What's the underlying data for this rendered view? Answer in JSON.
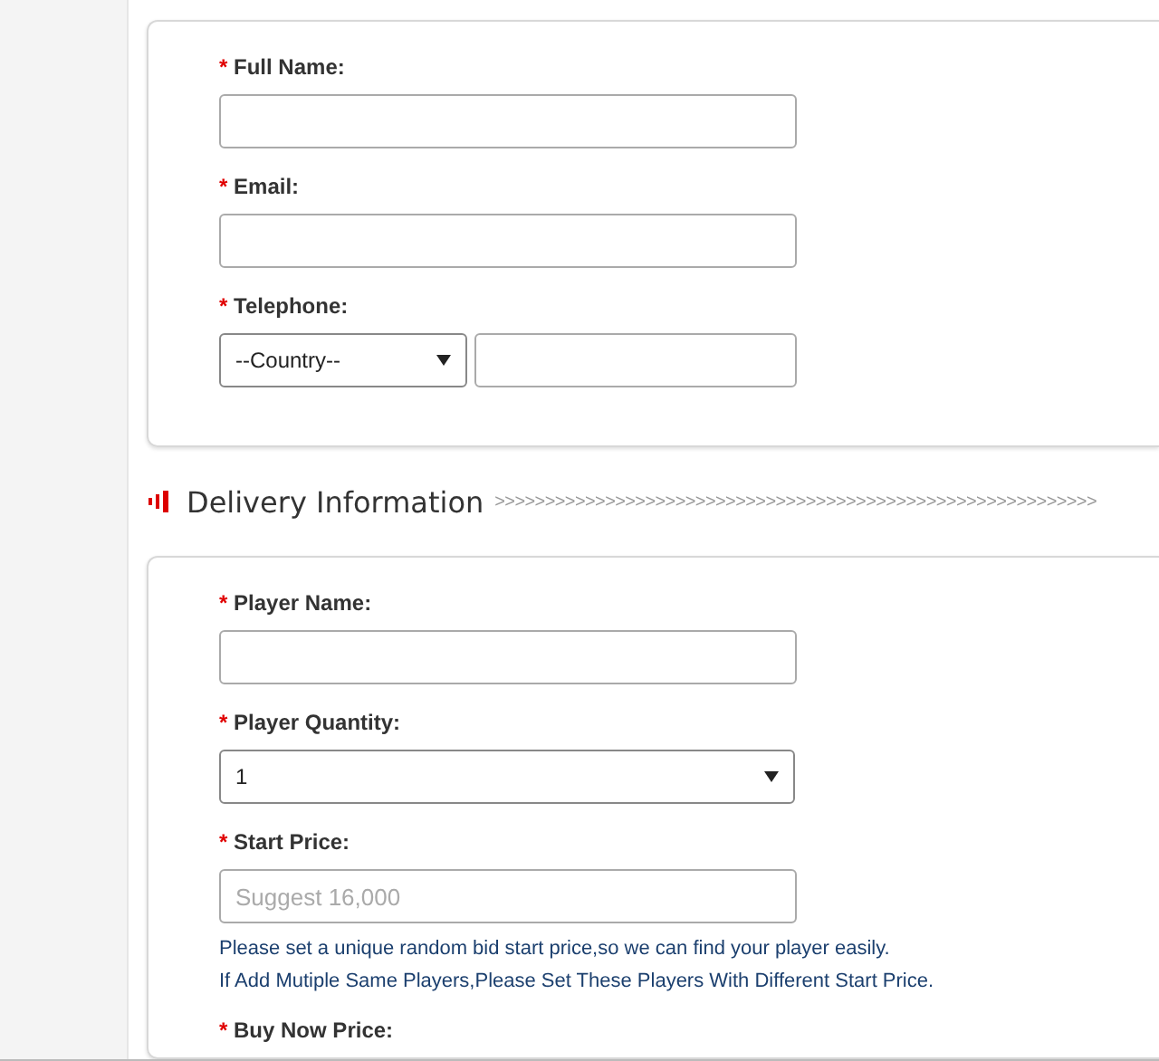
{
  "contact_card": {
    "fields": [
      {
        "kind": "text",
        "label": "Full Name:",
        "required": "*"
      },
      {
        "kind": "text",
        "label": "Email:",
        "required": "*"
      },
      {
        "kind": "phone",
        "label": "Telephone:",
        "required": "*",
        "country": "--Country--"
      }
    ]
  },
  "delivery_heading": {
    "title": "Delivery Information",
    "chevrons": ">>>>>>>>>>>>>>>>>>>>>>>>>>>>>>>>>>>>>>>>>>>>>>>>>>>>>>>>>>>>"
  },
  "delivery_card": {
    "fields": [
      {
        "kind": "text",
        "label": "Player Name:",
        "required": "*"
      },
      {
        "kind": "select",
        "label": "Player Quantity:",
        "required": "*",
        "value": "1"
      },
      {
        "kind": "text",
        "label": "Start Price:",
        "required": "*",
        "placeholder": "Suggest 16,000",
        "notes": [
          "Please set a unique random bid start price,so we can find your player easily.",
          "If Add Mutiple Same Players,Please Set These Players With Different Start Price."
        ]
      },
      {
        "kind": "label",
        "label": "Buy Now Price:",
        "required": "*"
      }
    ]
  }
}
